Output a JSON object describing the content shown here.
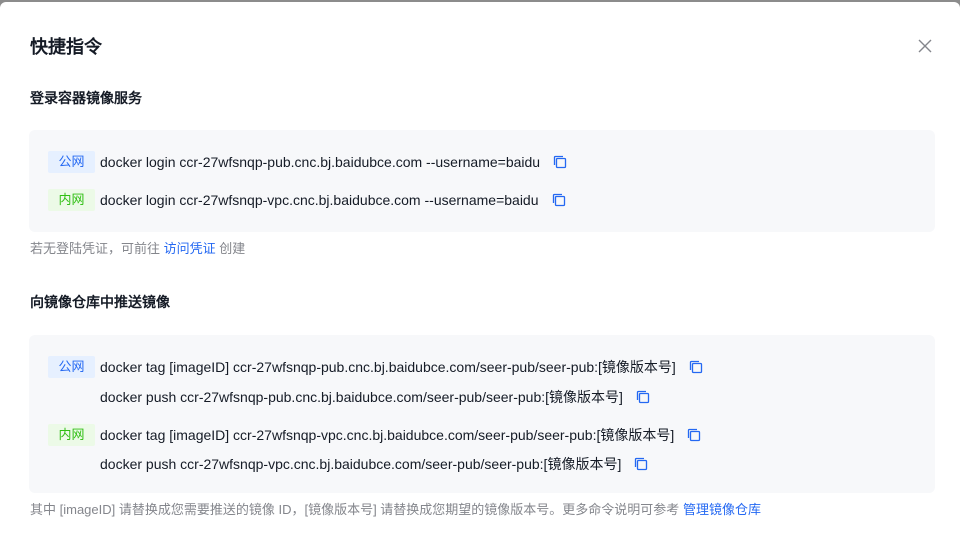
{
  "dialog": {
    "title": "快捷指令",
    "close_icon": "close-icon"
  },
  "login_section": {
    "title": "登录容器镜像服务",
    "rows": [
      {
        "tag": "公网",
        "command": "docker login ccr-27wfsnqp-pub.cnc.bj.baidubce.com --username=baidu"
      },
      {
        "tag": "内网",
        "command": "docker login ccr-27wfsnqp-vpc.cnc.bj.baidubce.com --username=baidu"
      }
    ],
    "hint_prefix": "若无登陆凭证，可前往",
    "hint_link": "访问凭证",
    "hint_suffix": "创建"
  },
  "push_section": {
    "title": "向镜像仓库中推送镜像",
    "public_tag": "公网",
    "public_tag_cmd": "docker tag [imageID] ccr-27wfsnqp-pub.cnc.bj.baidubce.com/seer-pub/seer-pub:[镜像版本号]",
    "public_push_cmd": "docker push ccr-27wfsnqp-pub.cnc.bj.baidubce.com/seer-pub/seer-pub:[镜像版本号]",
    "internal_tag": "内网",
    "internal_tag_cmd": "docker tag [imageID] ccr-27wfsnqp-vpc.cnc.bj.baidubce.com/seer-pub/seer-pub:[镜像版本号]",
    "internal_push_cmd": "docker push ccr-27wfsnqp-vpc.cnc.bj.baidubce.com/seer-pub/seer-pub:[镜像版本号]",
    "hint_text": "其中 [imageID] 请替换成您需要推送的镜像 ID，[镜像版本号] 请替换成您期望的镜像版本号。更多命令说明可参考",
    "hint_link": "管理镜像仓库"
  },
  "colors": {
    "accent": "#2468f2",
    "internal_green": "#30bf13",
    "box_bg": "#f7f8fa"
  }
}
